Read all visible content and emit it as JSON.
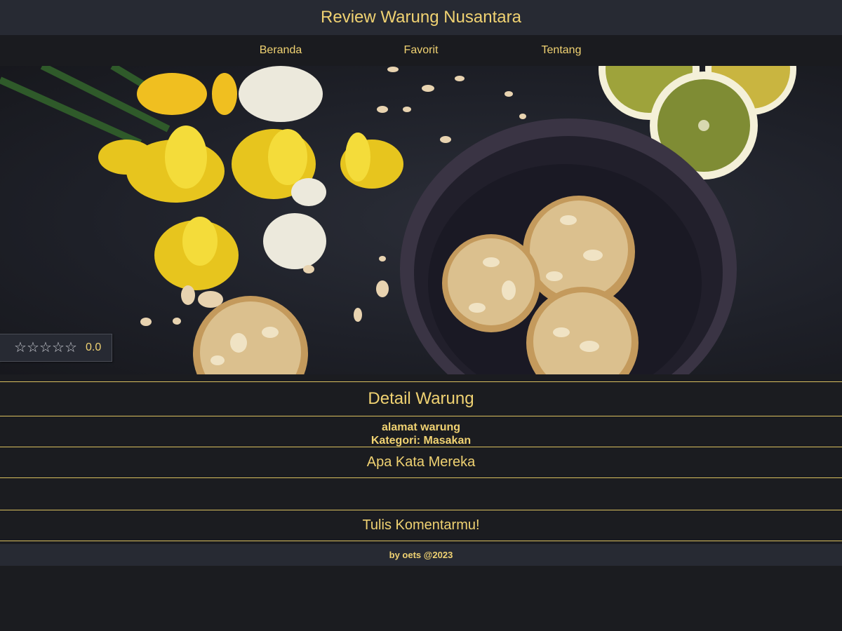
{
  "app": {
    "title": "Review Warung Nusantara"
  },
  "nav": {
    "items": [
      "Beranda",
      "Favorit",
      "Tentang"
    ]
  },
  "hero": {
    "image_desc_icon": "food-image",
    "rating": {
      "value": "0.0",
      "stars_filled": 0,
      "stars_total": 5
    }
  },
  "detail": {
    "title": "Detail Warung",
    "address": "alamat warung",
    "category": "Kategori: Masakan"
  },
  "reviews": {
    "title": "Apa Kata Mereka"
  },
  "comment": {
    "title": "Tulis Komentarmu!"
  },
  "footer": {
    "text": "by oets @2023"
  },
  "colors": {
    "accent": "#f0d272",
    "bg": "#1b1c20",
    "bar": "#272a33"
  }
}
